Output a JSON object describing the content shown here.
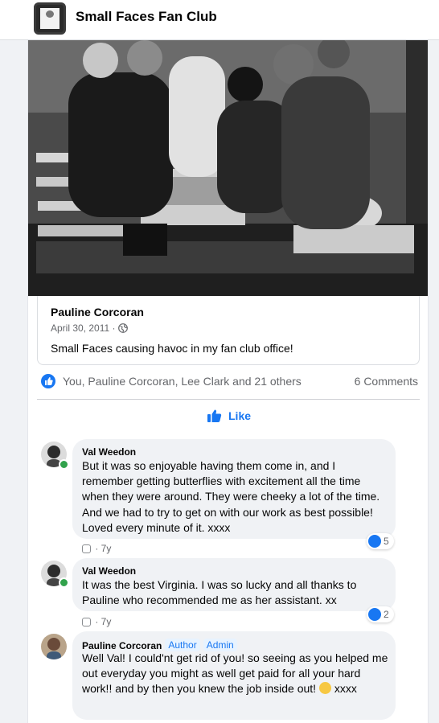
{
  "header": {
    "title": "Small Faces Fan Club"
  },
  "shared_post": {
    "author": "Pauline Corcoran",
    "date": "April 30, 2011 · ",
    "text": "Small Faces causing havoc in my fan club office!"
  },
  "reactions": {
    "names": "You, Pauline Corcoran, Lee Clark and 21 others",
    "comments_count": "6 Comments"
  },
  "actions": {
    "like_label": "Like"
  },
  "comments": [
    {
      "author": "Val Weedon",
      "text": "But it was so enjoyable having them come in, and I remember getting butterflies with excitement all the time when they were around. They were cheeky a lot of the time. And we had to try to get on with our work as best possible! Loved every minute of it. xxxx",
      "time": "7y",
      "reactions": "5"
    },
    {
      "author": "Val Weedon",
      "text": "It was the best Virginia. I was so lucky and all thanks to Pauline who recommended me as her assistant. xx",
      "time": "7y",
      "reactions": "2"
    },
    {
      "author": "Pauline Corcoran",
      "badge_author": "Author",
      "badge_admin": "Admin",
      "text": "Well Val! I could'nt get rid of you! so seeing as you helped me out everyday you might as well get paid for all your hard work!! and by then you knew the job inside out! ",
      "text_end": " xxxx"
    }
  ]
}
